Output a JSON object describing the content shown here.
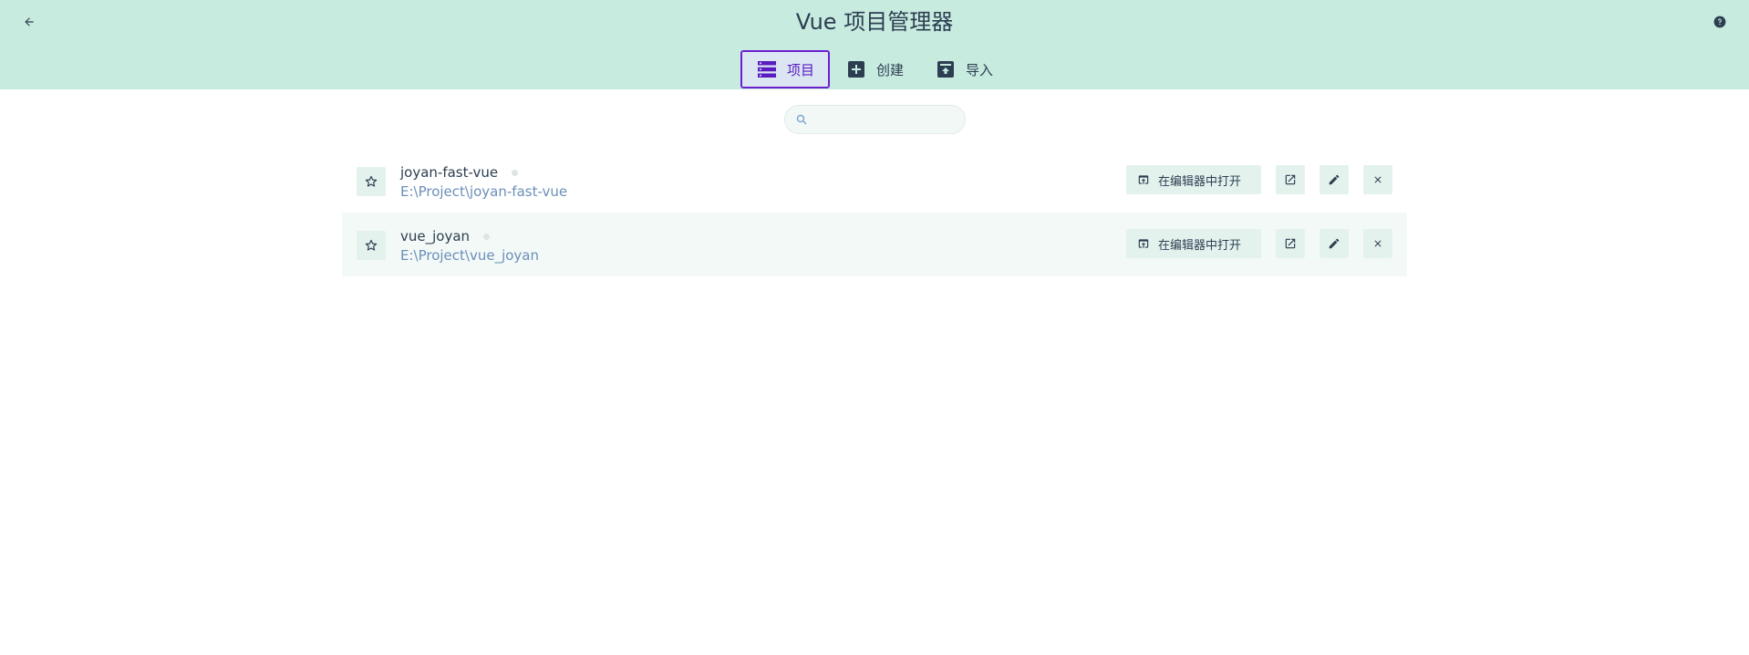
{
  "header": {
    "title": "Vue 项目管理器",
    "back_icon": "arrow-left-icon",
    "help_icon": "help-circle-icon",
    "background": "#c8ebe0"
  },
  "tabs": [
    {
      "label": "项目",
      "icon": "list-icon",
      "active": true
    },
    {
      "label": "创建",
      "icon": "plus-box-icon",
      "active": false
    },
    {
      "label": "导入",
      "icon": "import-box-icon",
      "active": false
    }
  ],
  "search": {
    "placeholder": "",
    "value": ""
  },
  "projects": [
    {
      "name": "joyan-fast-vue",
      "path": "E:\\Project\\joyan-fast-vue",
      "open_in_editor_label": "在编辑器中打开"
    },
    {
      "name": "vue_joyan",
      "path": "E:\\Project\\vue_joyan",
      "open_in_editor_label": "在编辑器中打开"
    }
  ],
  "colors": {
    "accent": "#6a1fd0",
    "path_text": "#6b8fb8",
    "button_bg": "#e4f2ee"
  }
}
